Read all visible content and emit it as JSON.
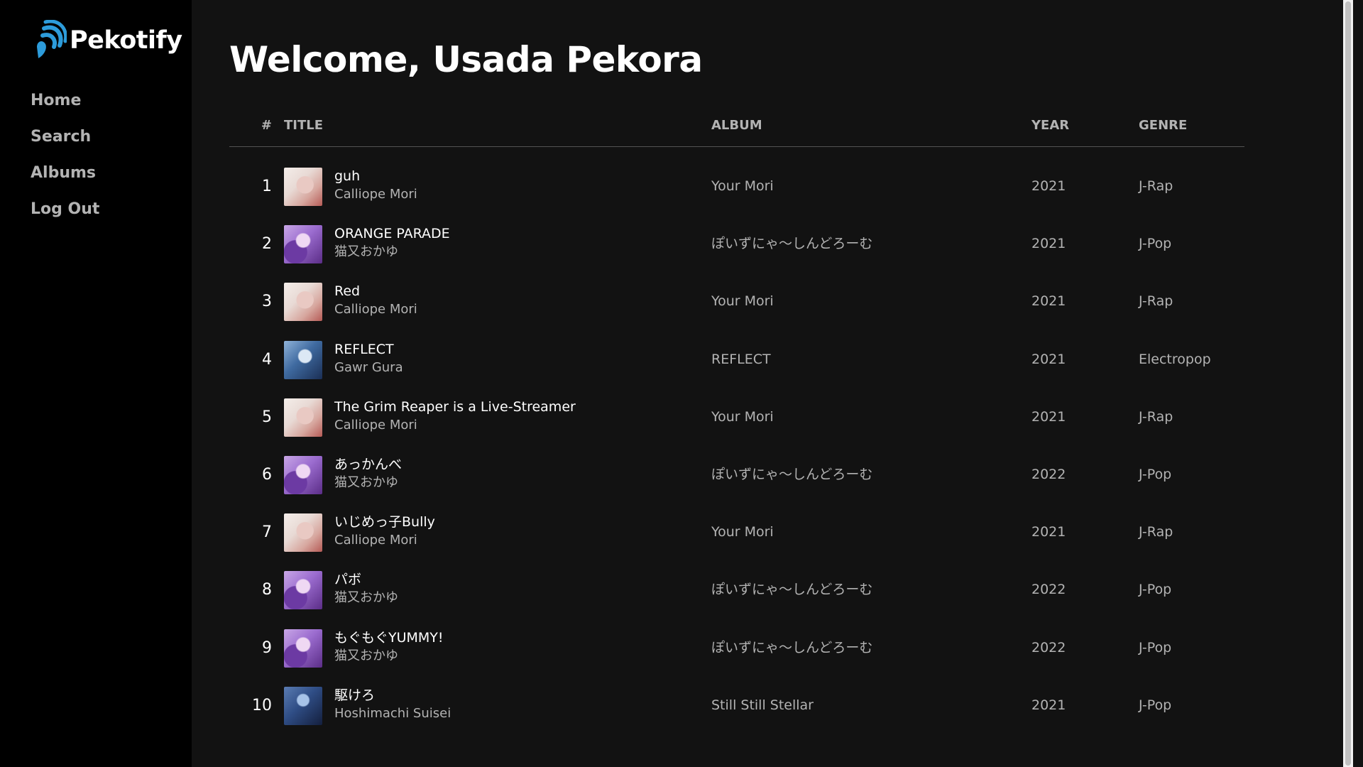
{
  "app": {
    "name": "Pekotify",
    "logo_icon": "sound-wave-icon",
    "accent": "#2d9cdb"
  },
  "sidebar": {
    "items": [
      {
        "label": "Home"
      },
      {
        "label": "Search"
      },
      {
        "label": "Albums"
      },
      {
        "label": "Log Out"
      }
    ]
  },
  "main": {
    "title": "Welcome, Usada Pekora",
    "table": {
      "headers": {
        "num": "#",
        "title": "TITLE",
        "album": "ALBUM",
        "year": "YEAR",
        "genre": "GENRE"
      },
      "rows": [
        {
          "num": "1",
          "title": "guh",
          "artist": "Calliope Mori",
          "album": "Your Mori",
          "year": "2021",
          "genre": "J-Rap",
          "cover": "cover-mori"
        },
        {
          "num": "2",
          "title": "ORANGE PARADE",
          "artist": "猫又おかゆ",
          "album": "ぽいずにゃ〜しんどろーむ",
          "year": "2021",
          "genre": "J-Pop",
          "cover": "cover-okayu"
        },
        {
          "num": "3",
          "title": "Red",
          "artist": "Calliope Mori",
          "album": "Your Mori",
          "year": "2021",
          "genre": "J-Rap",
          "cover": "cover-mori"
        },
        {
          "num": "4",
          "title": "REFLECT",
          "artist": "Gawr Gura",
          "album": "REFLECT",
          "year": "2021",
          "genre": "Electropop",
          "cover": "cover-gura"
        },
        {
          "num": "5",
          "title": "The Grim Reaper is a Live-Streamer",
          "artist": "Calliope Mori",
          "album": "Your Mori",
          "year": "2021",
          "genre": "J-Rap",
          "cover": "cover-mori"
        },
        {
          "num": "6",
          "title": "あっかんべ",
          "artist": "猫又おかゆ",
          "album": "ぽいずにゃ〜しんどろーむ",
          "year": "2022",
          "genre": "J-Pop",
          "cover": "cover-okayu"
        },
        {
          "num": "7",
          "title": "いじめっ子Bully",
          "artist": "Calliope Mori",
          "album": "Your Mori",
          "year": "2021",
          "genre": "J-Rap",
          "cover": "cover-mori"
        },
        {
          "num": "8",
          "title": "パボ",
          "artist": "猫又おかゆ",
          "album": "ぽいずにゃ〜しんどろーむ",
          "year": "2022",
          "genre": "J-Pop",
          "cover": "cover-okayu"
        },
        {
          "num": "9",
          "title": "もぐもぐYUMMY!",
          "artist": "猫又おかゆ",
          "album": "ぽいずにゃ〜しんどろーむ",
          "year": "2022",
          "genre": "J-Pop",
          "cover": "cover-okayu"
        },
        {
          "num": "10",
          "title": "駆けろ",
          "artist": "Hoshimachi Suisei",
          "album": "Still Still Stellar",
          "year": "2021",
          "genre": "J-Pop",
          "cover": "cover-suisei"
        }
      ]
    }
  }
}
